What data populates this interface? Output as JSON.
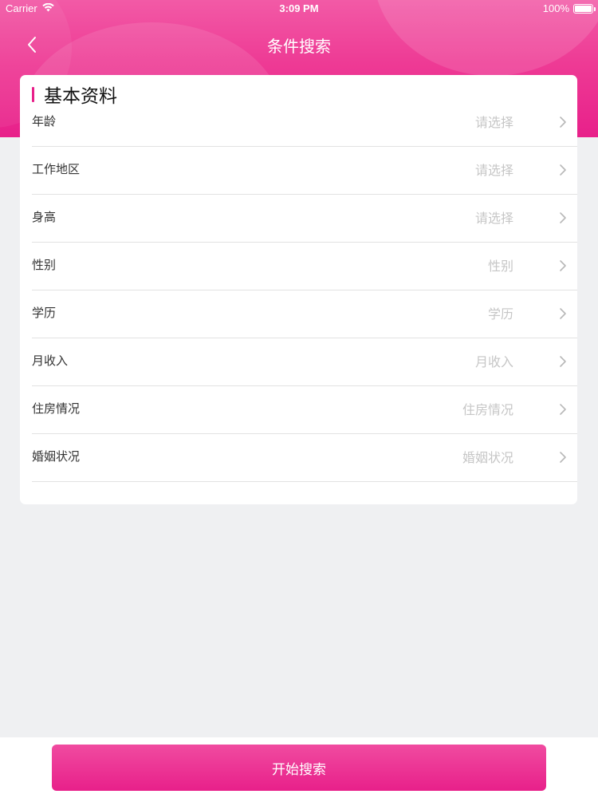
{
  "status_bar": {
    "carrier": "Carrier",
    "time": "3:09 PM",
    "battery": "100%"
  },
  "nav": {
    "title": "条件搜索",
    "back_icon": "chevron-left-icon"
  },
  "section": {
    "title": "基本资料",
    "accent_color": "#e8208a"
  },
  "rows": [
    {
      "label": "年龄",
      "value": "请选择"
    },
    {
      "label": "工作地区",
      "value": "请选择"
    },
    {
      "label": "身高",
      "value": "请选择"
    },
    {
      "label": "性别",
      "value": "性别"
    },
    {
      "label": "学历",
      "value": "学历"
    },
    {
      "label": "月收入",
      "value": "月收入"
    },
    {
      "label": "住房情况",
      "value": "住房情况"
    },
    {
      "label": "婚姻状况",
      "value": "婚姻状况"
    }
  ],
  "actions": {
    "search_label": "开始搜索"
  },
  "colors": {
    "brand_pink": "#e8208a",
    "page_bg": "#eff0f2",
    "placeholder": "#c6c6c6"
  }
}
